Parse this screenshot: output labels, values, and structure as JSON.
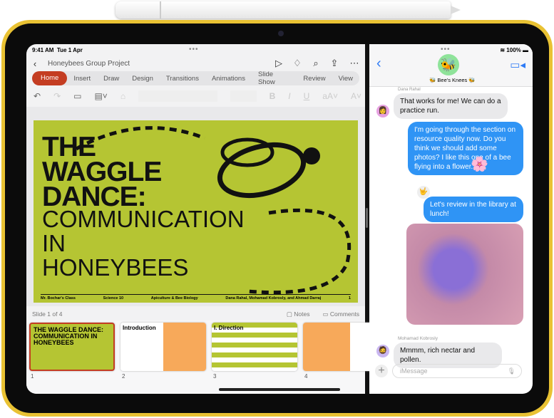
{
  "status": {
    "time": "9:41 AM",
    "date": "Tue 1 Apr",
    "battery": "100%"
  },
  "ppt": {
    "doc_title": "Honeybees Group Project",
    "tabs": [
      "Home",
      "Insert",
      "Draw",
      "Design",
      "Transitions",
      "Animations",
      "Slide Show",
      "Review",
      "View"
    ],
    "active_tab": "Home",
    "slide": {
      "title_lines": [
        "THE",
        "WAGGLE",
        "DANCE:"
      ],
      "subtitle_lines": [
        "COMMUNICATION",
        "IN",
        "HONEYBEES"
      ],
      "footer": [
        "Mr. Bochar's Class",
        "Science 10",
        "Apiculture & Bee Biology",
        "Dana Rahal, Mohamad Kobrosly, and Ahmad Darraj",
        "1"
      ]
    },
    "slide_counter": "Slide 1 of 4",
    "notes_label": "Notes",
    "comments_label": "Comments",
    "thumbnails": [
      {
        "number": "1",
        "title": "THE WAGGLE DANCE: COMMUNICATION IN HONEYBEES"
      },
      {
        "number": "2",
        "title": "Introduction"
      },
      {
        "number": "3",
        "title": "I. Direction"
      },
      {
        "number": "4",
        "title": ""
      }
    ],
    "accent": "#c43d22",
    "slide_color": "#b5c533"
  },
  "messages": {
    "group_name": "🐝 Bee's Knees 🐝",
    "sender1": "Dana Rahal",
    "m1": "That works for me! We can do a practice run.",
    "m2": "I'm going through the section on resource quality now. Do you think we should add some photos? I like this one of a bee flying into a flower.",
    "m2_tapback": "🌸",
    "m3_reaction": "🤟",
    "m3": "Let's review in the library at lunch!",
    "sender2": "Mohamad Kobrosly",
    "m4": "Mmmm, rich nectar and pollen.",
    "input_placeholder": "iMessage",
    "bubble_color": "#2f94f5"
  }
}
